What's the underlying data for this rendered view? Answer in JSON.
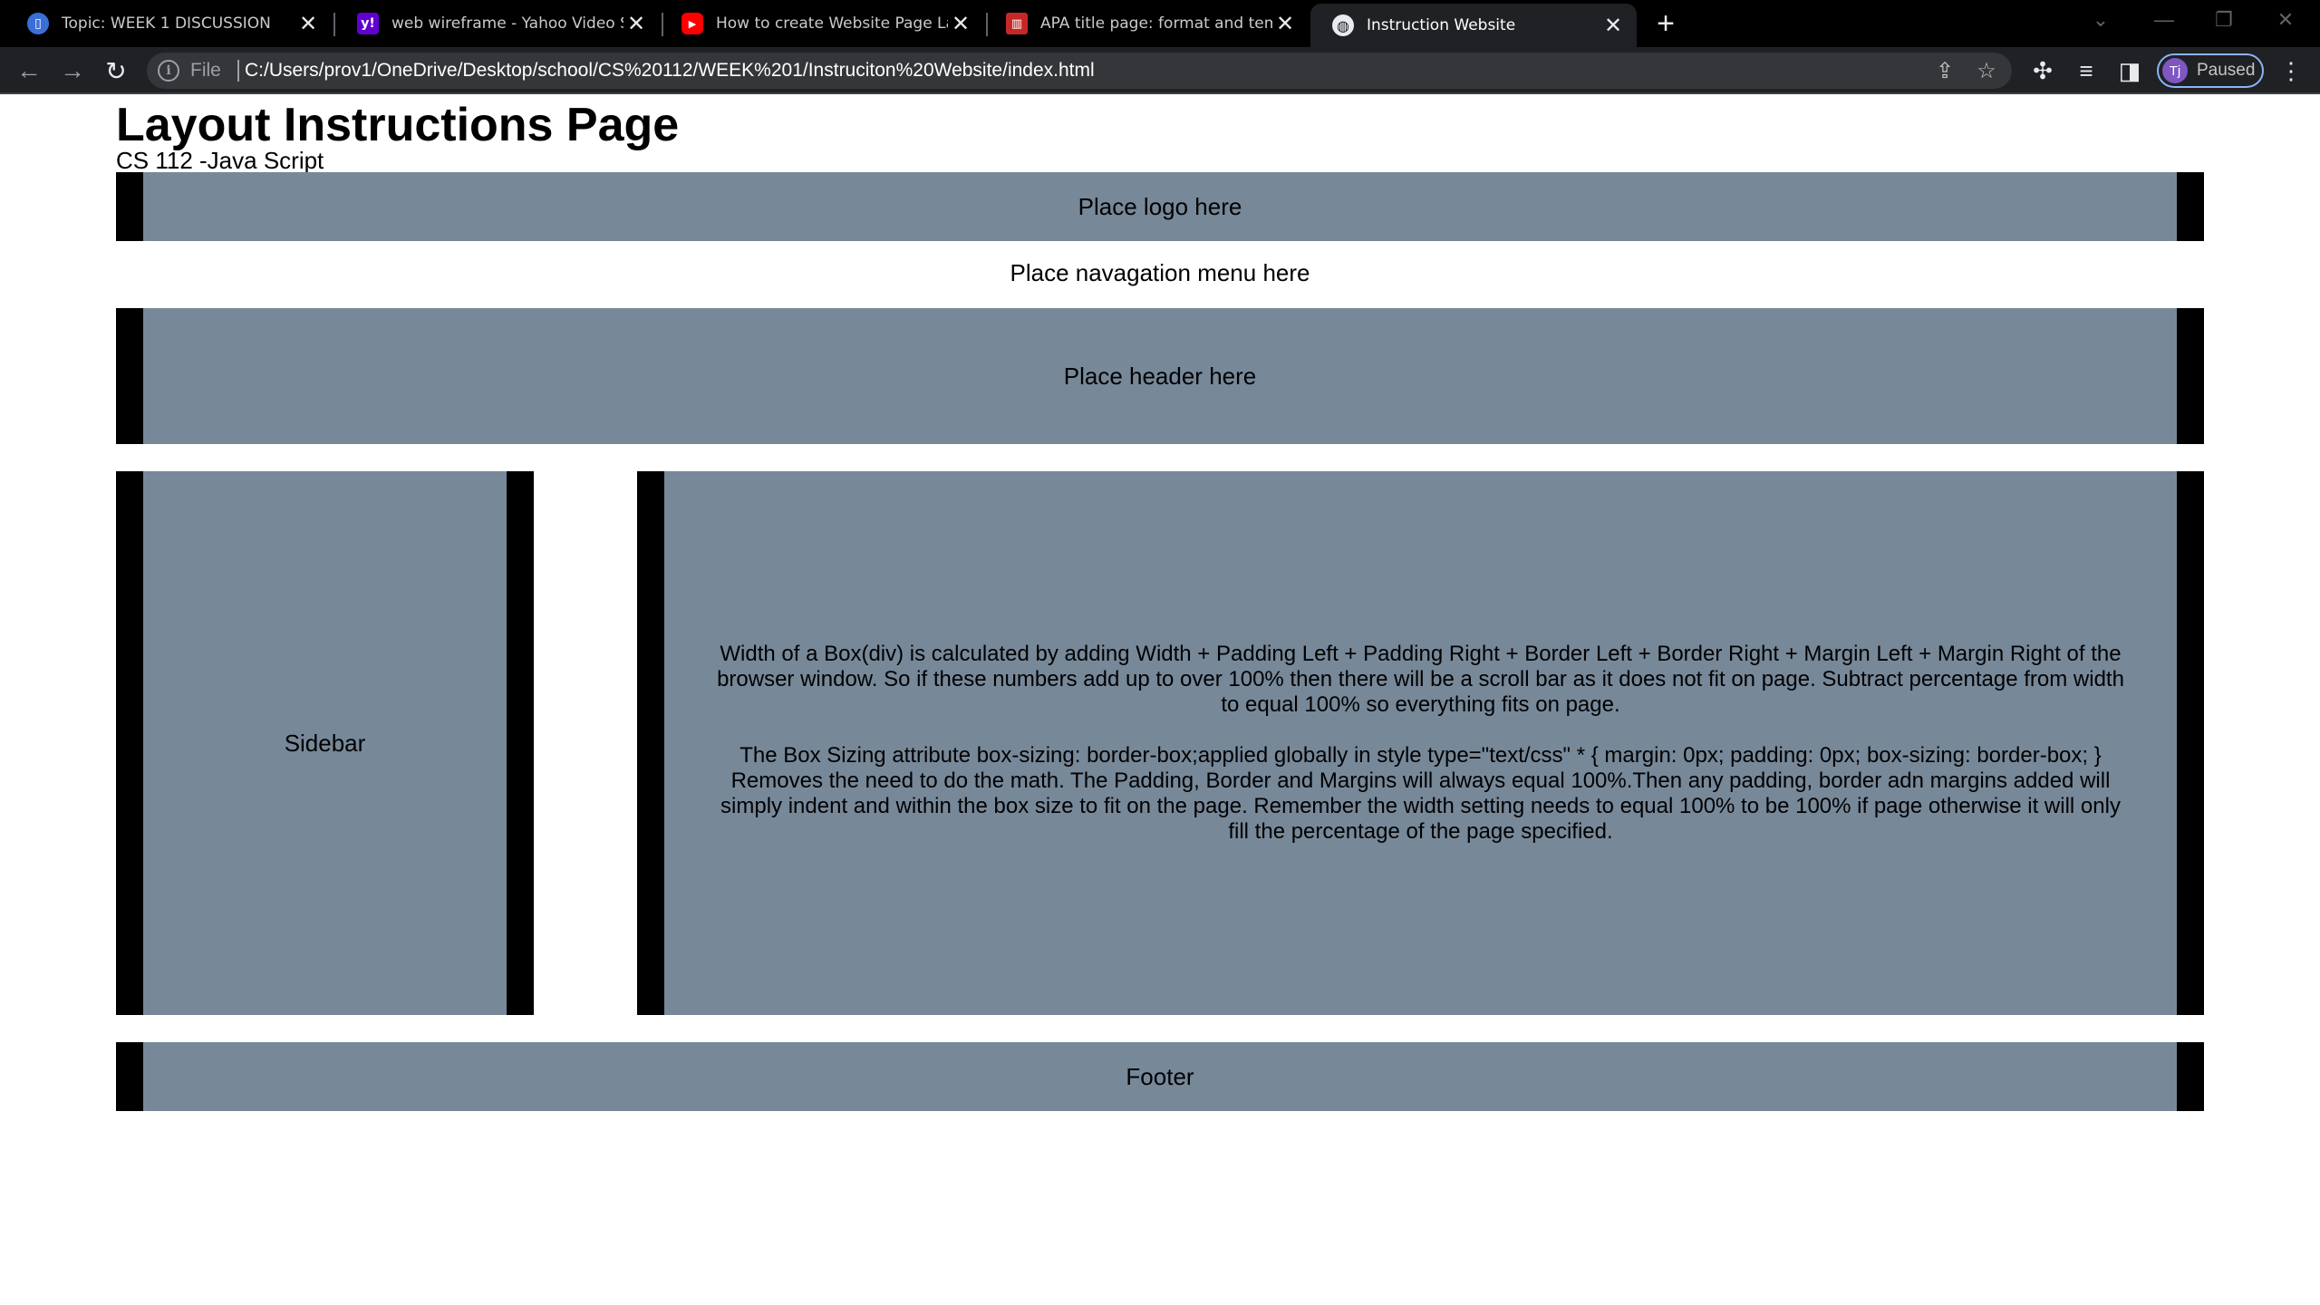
{
  "browser": {
    "tabs": [
      {
        "title": "Topic: WEEK 1 DISCUSSION",
        "favicon": "course-icon",
        "active": false
      },
      {
        "title": "web wireframe - Yahoo Video Se",
        "favicon": "yahoo-icon",
        "active": false
      },
      {
        "title": "How to create Website Page Lay",
        "favicon": "youtube-icon",
        "active": false
      },
      {
        "title": "APA title page: format and templ",
        "favicon": "book-icon",
        "active": false
      },
      {
        "title": "Instruction Website",
        "favicon": "globe-icon",
        "active": true
      }
    ],
    "address": {
      "scheme_label": "File",
      "url": "C:/Users/prov1/OneDrive/Desktop/school/CS%20112/WEEK%201/Instruciton%20Website/index.html"
    },
    "profile": {
      "initials": "Tj",
      "status": "Paused"
    }
  },
  "page": {
    "title": "Layout Instructions Page",
    "subtitle": "CS 112 -Java Script",
    "logo_text": "Place logo here",
    "nav_text": "Place navagation menu here",
    "header_text": "Place header here",
    "sidebar_text": "Sidebar",
    "content_p1": "Width of a Box(div) is calculated by adding Width + Padding Left + Padding Right + Border Left + Border Right + Margin Left + Margin Right of the browser window. So if these numbers add up to over 100% then there will be a scroll bar as it does not fit on page. Subtract percentage from width to equal 100% so everything fits on page.",
    "content_p2": "The Box Sizing attribute box-sizing: border-box;applied globally in style type=\"text/css\" * { margin: 0px; padding: 0px; box-sizing: border-box; } Removes the need to do the math. The Padding, Border and Margins will always equal 100%.Then any padding, border adn margins added will simply indent and within the box size to fit on the page. Remember the width setting needs to equal 100% to be 100% if page otherwise it will only fill the percentage of the page specified.",
    "footer_text": "Footer"
  },
  "colors": {
    "box_fill": "#778899",
    "box_border": "#000000",
    "tabbar_bg": "#000000",
    "toolbar_bg": "#202124"
  }
}
